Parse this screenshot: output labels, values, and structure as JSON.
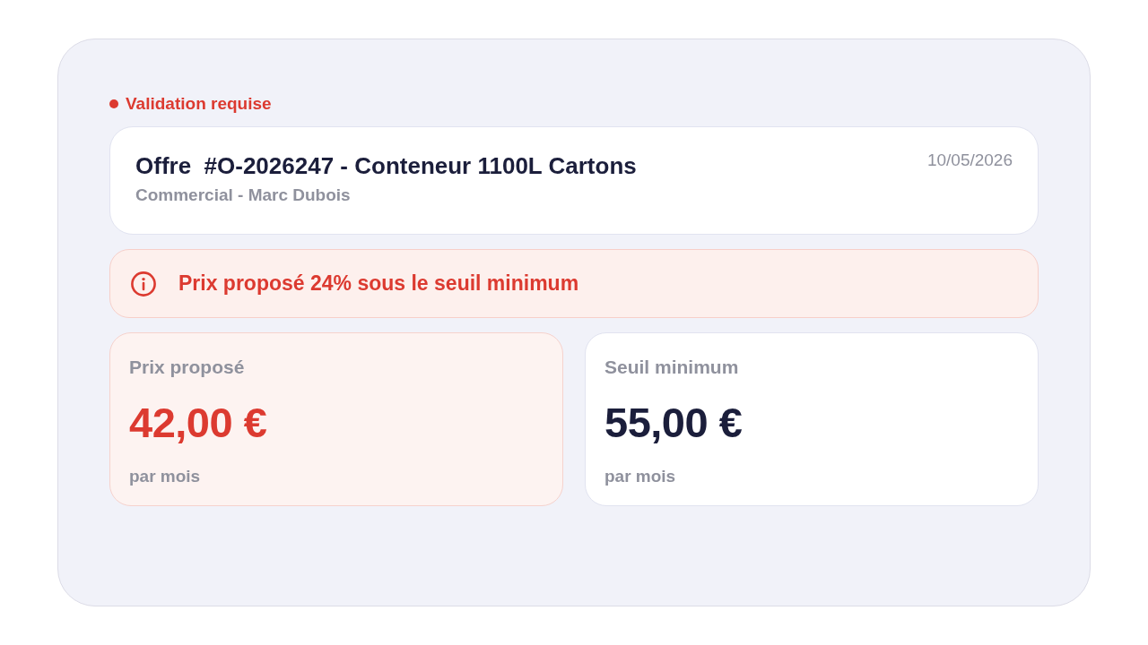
{
  "status": {
    "label": "Validation requise",
    "kind": "danger"
  },
  "offer": {
    "title": "Offre  #O-2026247 - Conteneur 1100L Cartons",
    "subtitle": "Commercial - Marc Dubois",
    "date": "10/05/2026"
  },
  "alert": {
    "kind": "danger",
    "message": "Prix proposé 24% sous le seuil minimum"
  },
  "prices": [
    {
      "kind": "danger",
      "label": "Prix proposé",
      "amount": "42,00 €",
      "period": "par mois"
    },
    {
      "kind": "neutral",
      "label": "Seuil minimum",
      "amount": "55,00 €",
      "period": "par mois"
    }
  ]
}
